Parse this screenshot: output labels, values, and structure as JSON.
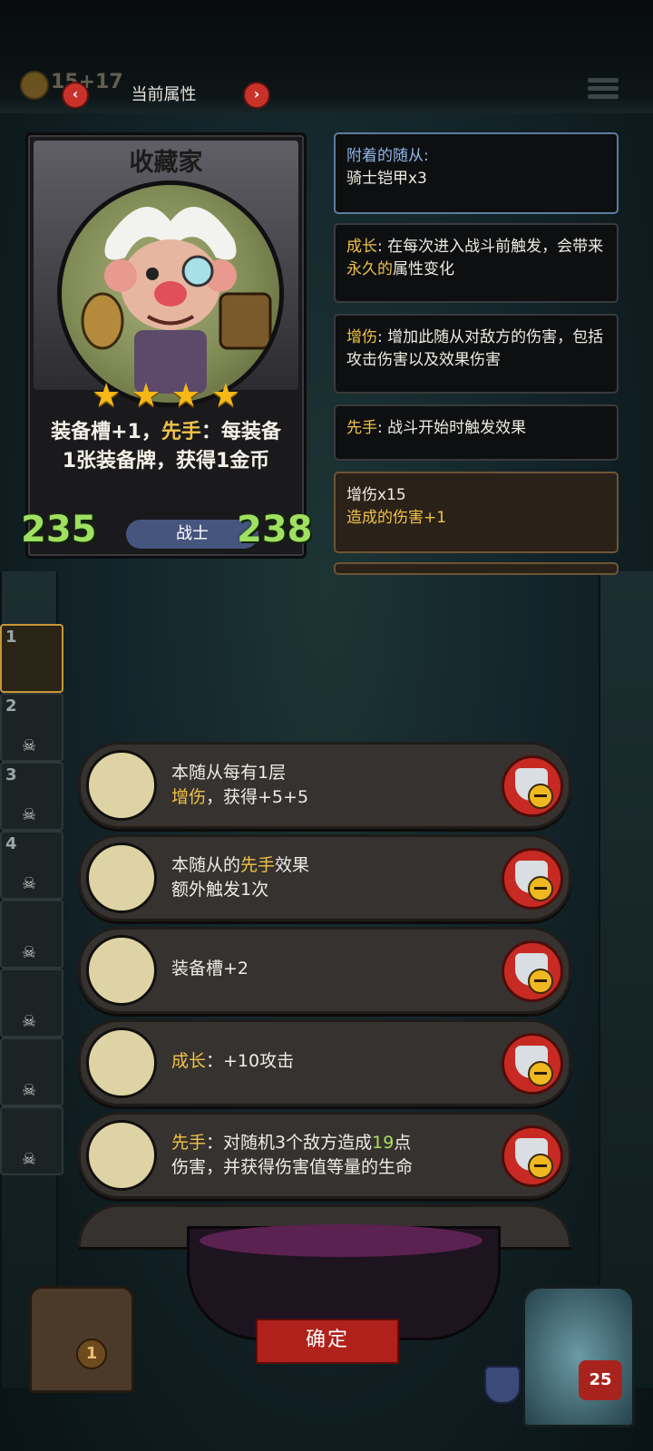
{
  "header": {
    "title": "当前属性",
    "gold_text": "15+17",
    "prev": "‹",
    "next": "›"
  },
  "card": {
    "name": "收藏家",
    "stars": 4,
    "star_glyph": "★",
    "desc_part1": "装备槽+1，",
    "desc_highlight": "先手",
    "desc_part2": "：每装备1张装备牌，获得1金币",
    "attack": "235",
    "health": "238",
    "class_label": "战士"
  },
  "panels": [
    {
      "label": "附着的随从:",
      "text": "骑士铠甲x3"
    },
    {
      "label": "成长",
      "text_pre": ": 在每次进入战斗前触发，会带来",
      "text_hl": "永久的",
      "text_post": "属性变化"
    },
    {
      "label": "增伤",
      "text": ": 增加此随从对敌方的伤害，包括攻击伤害以及效果伤害"
    },
    {
      "label": "先手",
      "text": ": 战斗开始时触发效果"
    },
    {
      "line1": "增伤x15",
      "line2": "造成的伤害+1"
    }
  ],
  "lineup": [
    "1",
    "2",
    "3",
    "4",
    "",
    "",
    "",
    ""
  ],
  "skull_glyph": "☠",
  "upgrades": [
    {
      "icon": "bat-staff-icon",
      "line1": "本随从每有1层",
      "line2_hl": "增伤",
      "line2": "，获得+5+5"
    },
    {
      "icon": "orb-charm-icon",
      "line1_pre": "本随从的",
      "line1_hl": "先手",
      "line1_post": "效果",
      "line2": "额外触发1次"
    },
    {
      "icon": "pig-icon",
      "line1": "装备槽+2"
    },
    {
      "icon": "fire-axe-icon",
      "line1_hl": "成长",
      "line1_post": "：+10攻击"
    },
    {
      "icon": "spectral-blade-icon",
      "line1_hl": "先手",
      "line1_mid": "：对随机3个敌方造成",
      "line1_num": "19",
      "line1_post": "点",
      "line2": "伤害，并获得伤害值等量的生命"
    }
  ],
  "footer": {
    "confirm": "确定",
    "chest_count": "1",
    "hero_health": "25"
  },
  "colors": {
    "accent_gold": "#f0c24a",
    "stat_green": "#9fe060",
    "button_red": "#b0211c"
  }
}
